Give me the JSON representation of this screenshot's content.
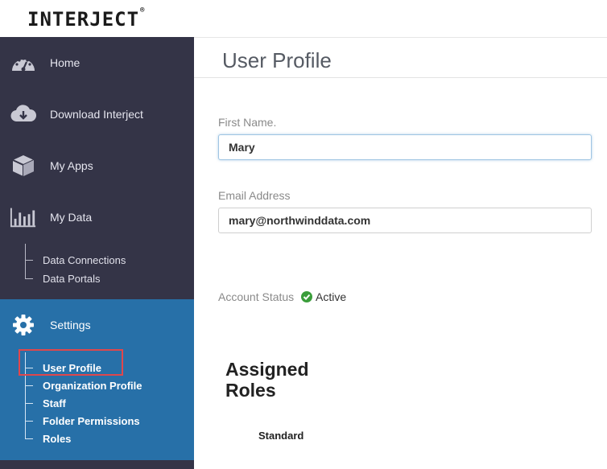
{
  "app": {
    "logo": "INTERJECT",
    "logo_mark": "®"
  },
  "sidebar": {
    "items": [
      {
        "label": "Home",
        "icon": "dashboard-gauge-icon"
      },
      {
        "label": "Download Interject",
        "icon": "cloud-download-icon"
      },
      {
        "label": "My Apps",
        "icon": "cube-icon"
      },
      {
        "label": "My Data",
        "icon": "bar-chart-icon"
      },
      {
        "label": "Settings",
        "icon": "gear-icon"
      }
    ],
    "my_data_sub": [
      "Data Connections",
      "Data Portals"
    ],
    "settings_sub": [
      "User Profile",
      "Organization Profile",
      "Staff",
      "Folder Permissions",
      "Roles"
    ],
    "active_sub": "User Profile",
    "colors": {
      "sidebar_bg": "#343447",
      "settings_bg": "#2770a8",
      "highlight": "#e0474c"
    }
  },
  "main": {
    "title": "User Profile",
    "first_name": {
      "label": "First Name.",
      "value": "Mary"
    },
    "email": {
      "label": "Email Address",
      "value": "mary@northwinddata.com"
    },
    "account_status": {
      "label": "Account Status",
      "value": "Active",
      "icon": "check-circle-icon",
      "color": "#3a9d3a"
    },
    "roles": {
      "title": "Assigned Roles",
      "items": [
        "Standard"
      ]
    }
  }
}
